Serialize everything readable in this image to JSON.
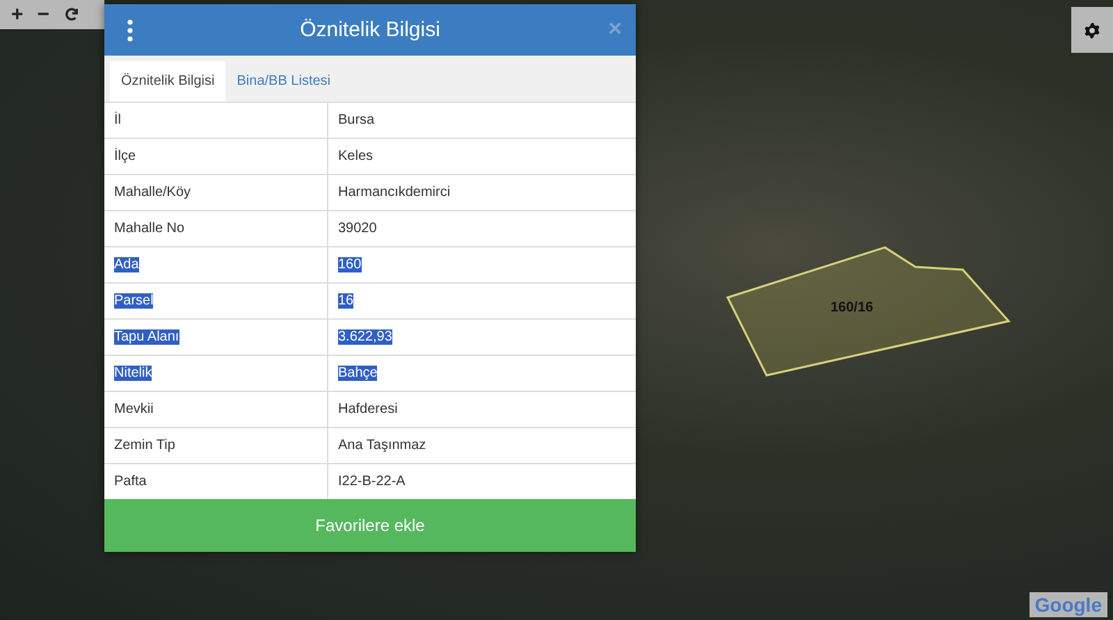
{
  "map_controls": [
    "+",
    "−"
  ],
  "dialog": {
    "title": "Öznitelik Bilgisi",
    "close": "×",
    "tabs": [
      {
        "label": "Öznitelik Bilgisi",
        "selected": true
      },
      {
        "label": "Bina/BB Listesi",
        "selected": false
      }
    ],
    "rows": [
      {
        "label": "İl",
        "value": "Bursa",
        "highlighted": false
      },
      {
        "label": "İlçe",
        "value": "Keles",
        "highlighted": false
      },
      {
        "label": "Mahalle/Köy",
        "value": "Harmancıkdemirci",
        "highlighted": false
      },
      {
        "label": "Mahalle No",
        "value": "39020",
        "highlighted": false
      },
      {
        "label": "Ada",
        "value": "160",
        "highlighted": true
      },
      {
        "label": "Parsel",
        "value": "16",
        "highlighted": true
      },
      {
        "label": "Tapu Alanı",
        "value": "3.622,93",
        "highlighted": true
      },
      {
        "label": "Nitelik",
        "value": "Bahçe",
        "highlighted": true
      },
      {
        "label": "Mevkii",
        "value": "Hafderesi",
        "highlighted": false
      },
      {
        "label": "Zemin Tip",
        "value": "Ana Taşınmaz",
        "highlighted": false
      },
      {
        "label": "Pafta",
        "value": "I22-B-22-A",
        "highlighted": false
      }
    ],
    "button": "Favorilere ekle"
  },
  "parcel_label": "160/16",
  "attribution": "Google"
}
